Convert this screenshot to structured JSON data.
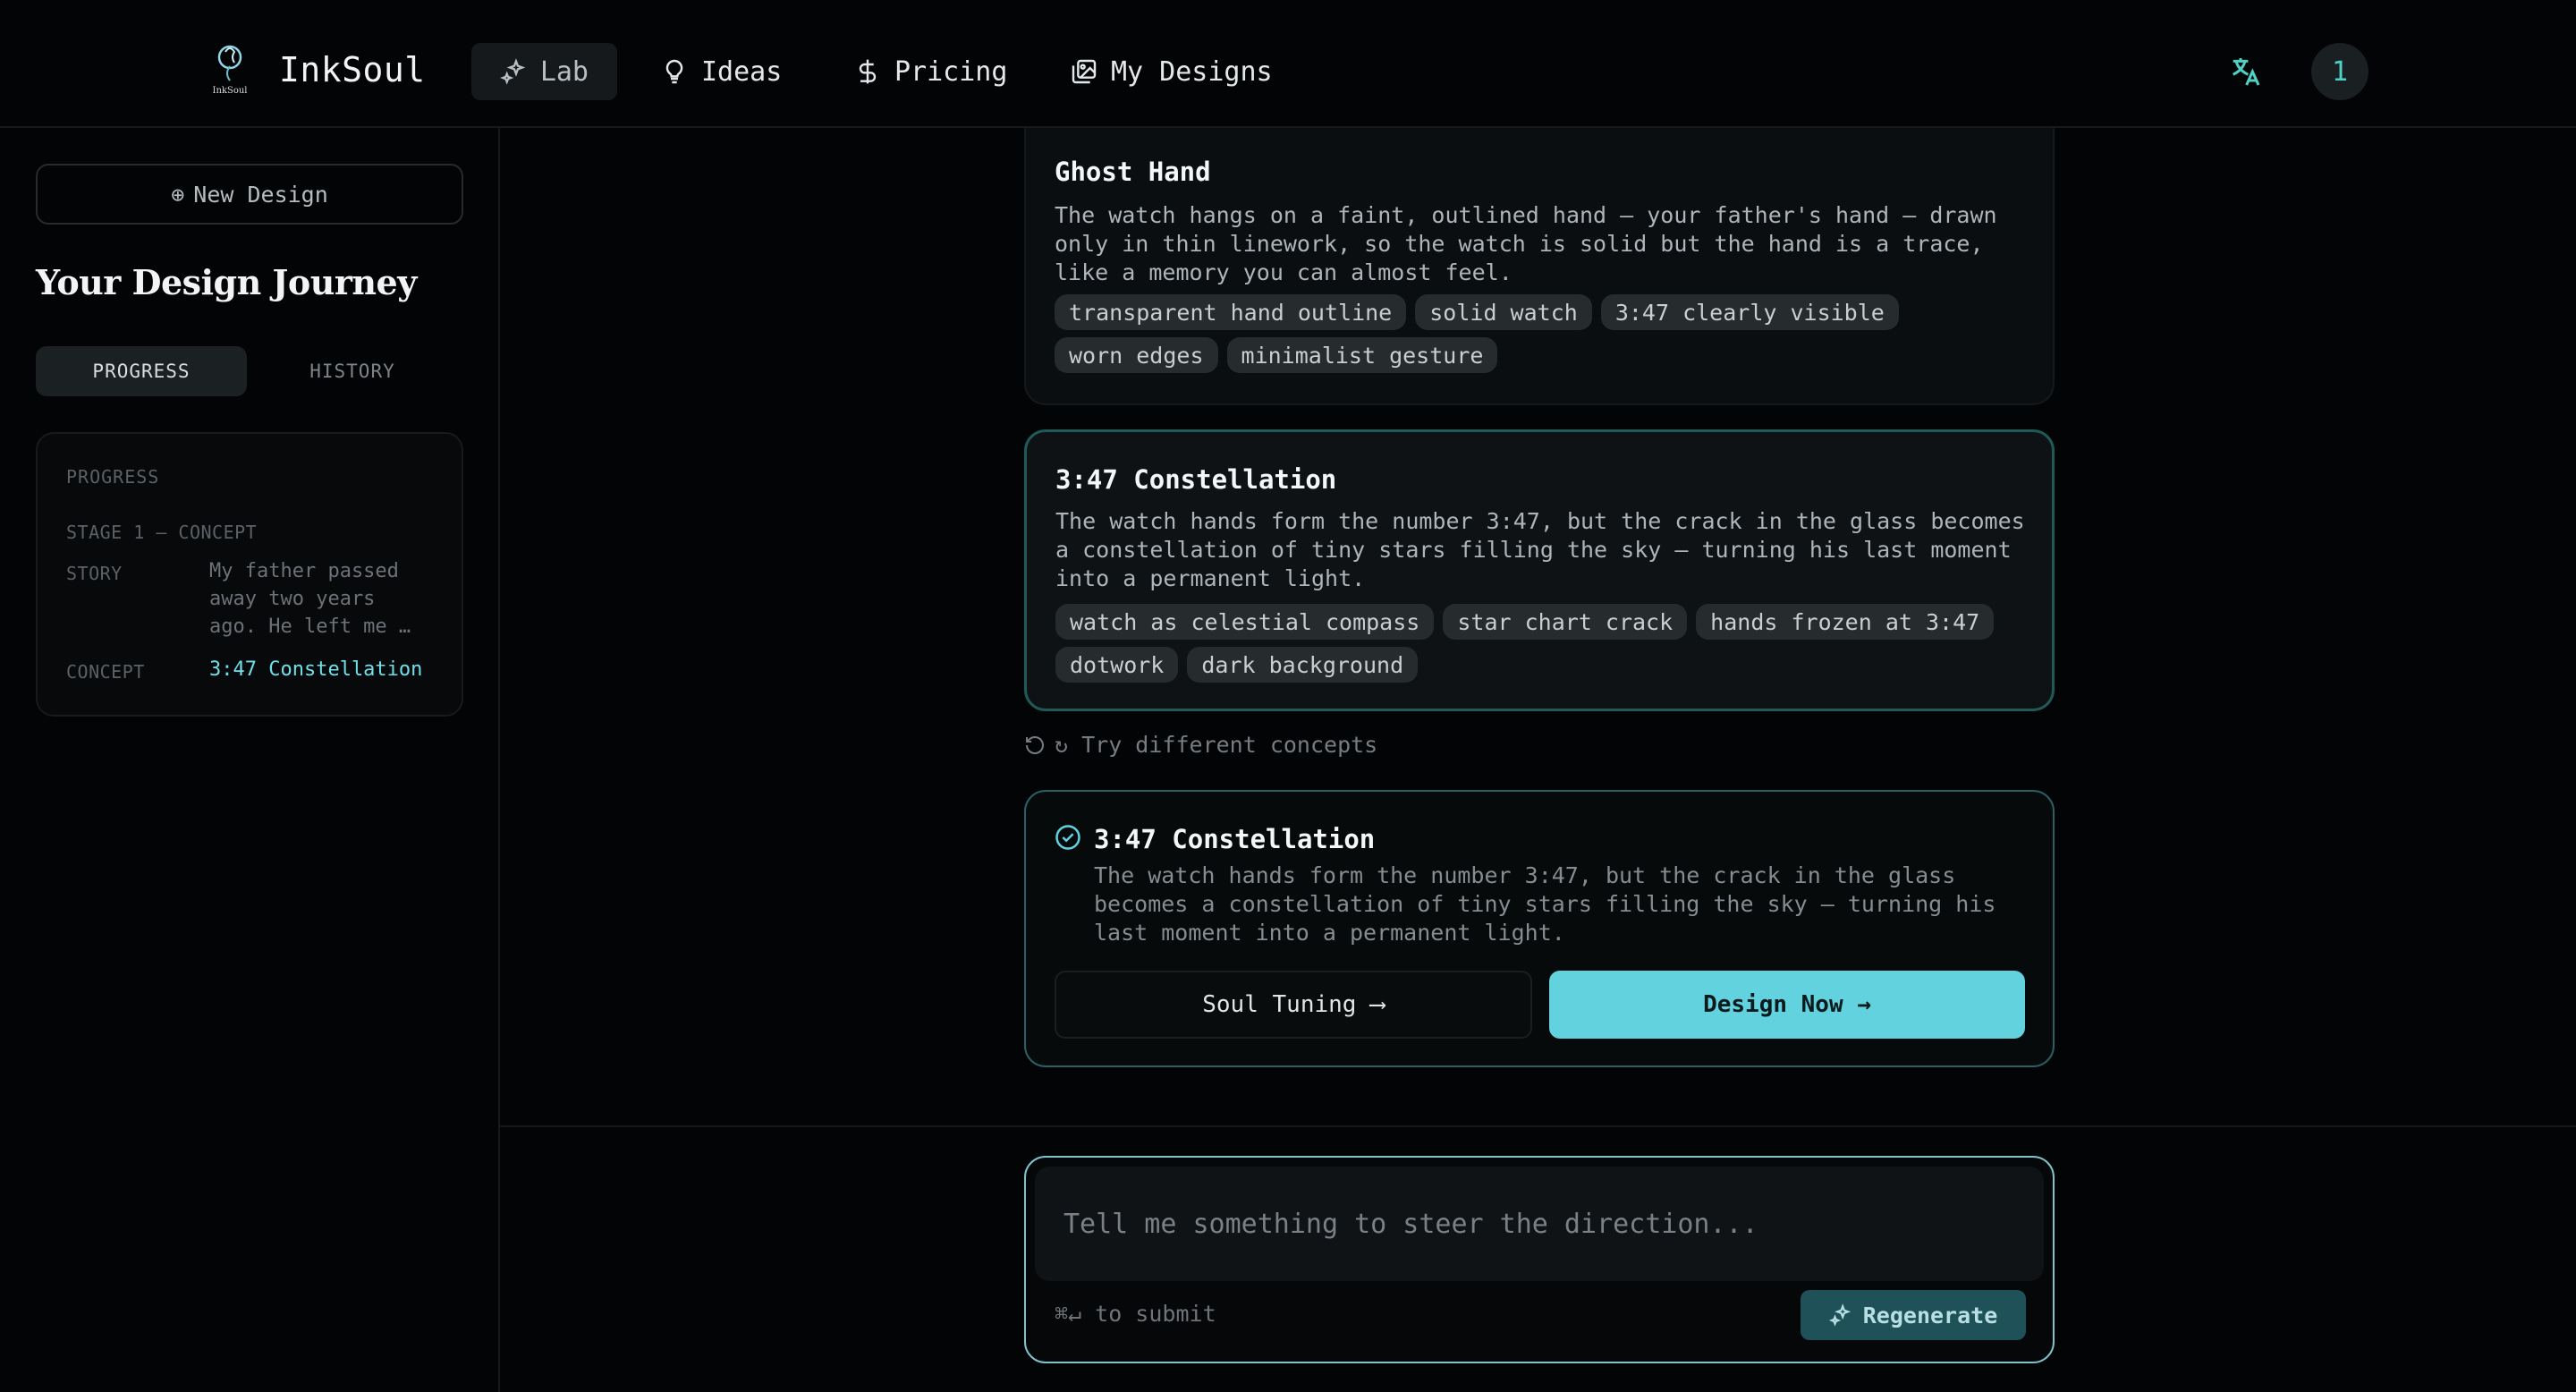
{
  "app": {
    "brand": "InkSoul",
    "logo_text": "InkSoul",
    "avatar_initial": "1"
  },
  "nav": [
    {
      "label": "Lab",
      "icon": "sparkles-icon"
    },
    {
      "label": "Ideas",
      "icon": "lightbulb-icon"
    },
    {
      "label": "Pricing",
      "icon": "dollar-icon"
    },
    {
      "label": "My Designs",
      "icon": "images-icon"
    }
  ],
  "sidebar": {
    "new_design": "New Design",
    "title": "Your Design Journey",
    "tabs": [
      "PROGRESS",
      "HISTORY"
    ],
    "progress": {
      "label": "PROGRESS",
      "stage": "STAGE 1 — CONCEPT",
      "story_key": "STORY",
      "story_value": "My father passed away two years ago. He left me …",
      "concept_key": "CONCEPT",
      "concept_value": "3:47 Constellation"
    }
  },
  "concepts": [
    {
      "title": "Ghost Hand",
      "description": "The watch hangs on a faint, outlined hand — your father's hand — drawn only in thin linework, so the watch is solid but the hand is a trace, like a memory you can almost feel.",
      "tags": [
        "transparent hand outline",
        "solid watch",
        "3:47 clearly visible",
        "worn edges",
        "minimalist gesture"
      ]
    },
    {
      "title": "3:47 Constellation",
      "description": "The watch hands form the number 3:47, but the crack in the glass becomes a constellation of tiny stars filling the sky — turning his last moment into a permanent light.",
      "tags": [
        "watch as celestial compass",
        "star chart crack",
        "hands frozen at 3:47",
        "dotwork",
        "dark background"
      ]
    }
  ],
  "try_different": "↻ Try different concepts",
  "selected": {
    "title": "3:47 Constellation",
    "description": "The watch hands form the number 3:47, but the crack in the glass becomes a constellation of tiny stars filling the sky — turning his last moment into a permanent light.",
    "soul_tuning": "Soul Tuning ⟶",
    "design_now": "Design Now →"
  },
  "composer": {
    "placeholder": "Tell me something to steer the direction...",
    "hint": "⌘↵ to submit",
    "regenerate": "Regenerate"
  },
  "colors": {
    "accent": "#62d3de",
    "teal_text": "#6ee0ea",
    "background": "#030405"
  }
}
